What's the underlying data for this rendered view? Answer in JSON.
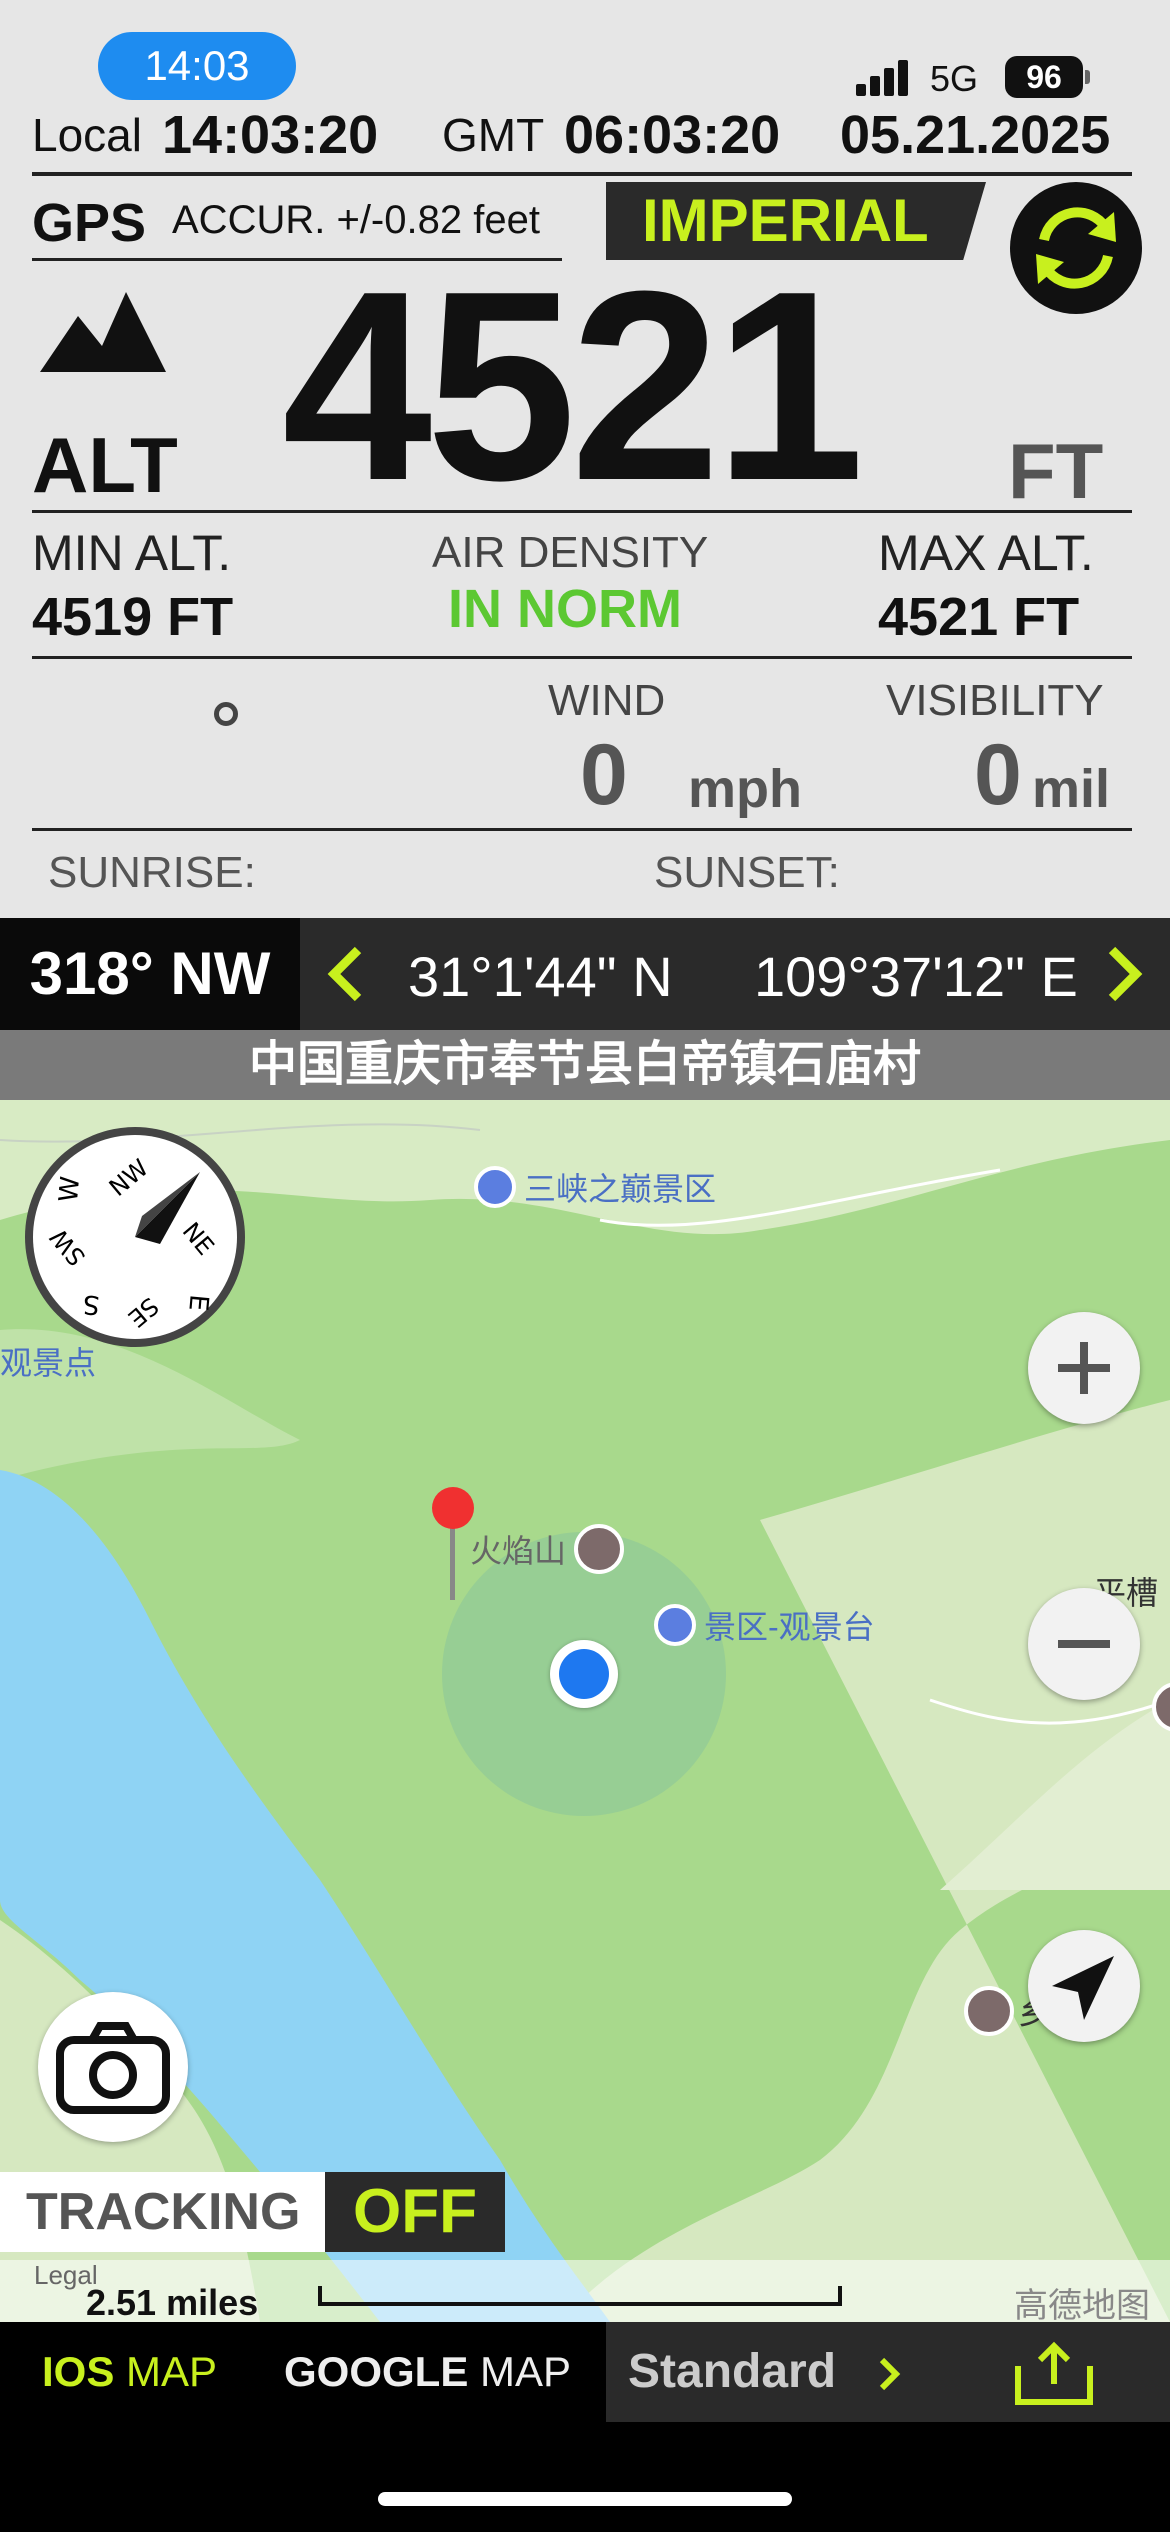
{
  "status_bar": {
    "time": "14:03",
    "network": "5G",
    "battery": "96"
  },
  "clock": {
    "local_label": "Local",
    "local_time": "14:03:20",
    "gmt_label": "GMT",
    "gmt_time": "06:03:20",
    "date": "05.21.2025"
  },
  "gps": {
    "label": "GPS",
    "accuracy": "ACCUR. +/-0.82 feet"
  },
  "units_button": "IMPERIAL",
  "altitude": {
    "label": "ALT",
    "value": "4521",
    "unit": "FT"
  },
  "min_alt": {
    "label": "MIN  ALT.",
    "value": "4519 FT"
  },
  "air_density": {
    "label": "AIR DENSITY",
    "value": "IN NORM"
  },
  "max_alt": {
    "label": "MAX  ALT.",
    "value": "4521 FT"
  },
  "degree_symbol": "°",
  "wind": {
    "label": "WIND",
    "value": "0",
    "unit": "mph"
  },
  "visibility": {
    "label": "VISIBILITY",
    "value": "0",
    "unit": "mil"
  },
  "sun": {
    "sunrise_label": "SUNRISE:",
    "sunset_label": "SUNSET:"
  },
  "heading": "318° NW",
  "coords": {
    "lat": "31°1'44\" N",
    "lon": "109°37'12\" E"
  },
  "address": "中国重庆市奉节县白帝镇石庙村",
  "map": {
    "pois": {
      "sanxia": "三峡之巅景区",
      "guanjingdian": "观景点",
      "huoyanshan": "火焰山",
      "jingqu": "景区-观景台",
      "pingcao": "平槽",
      "partial": "乡"
    },
    "compass_labels": [
      "NW",
      "NE",
      "SE",
      "SW",
      "W",
      "E",
      "S"
    ],
    "tracking_label": "TRACKING",
    "tracking_state": "OFF",
    "legal": "Legal",
    "scale": "2.51 miles",
    "attribution": "高德地图",
    "colors": {
      "water": "#8fd3f4",
      "forest": "#a6d68a",
      "light": "#d6e8c0",
      "accent": "#c8f01e",
      "location": "#1e78f0"
    }
  },
  "tabs": {
    "ios_bold": "IOS",
    "ios_rest": " MAP",
    "google_bold": "GOOGLE",
    "google_rest": " MAP",
    "standard": "Standard"
  }
}
